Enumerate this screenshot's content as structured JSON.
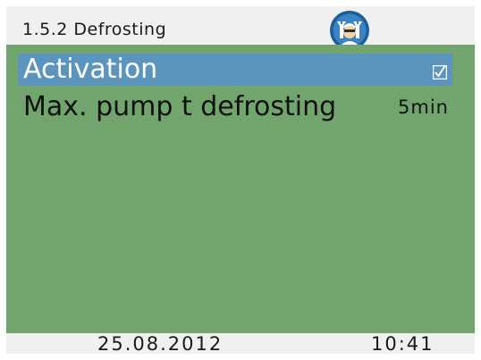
{
  "header": {
    "title": "1.5.2 Defrosting",
    "icon": "service-technician-icon"
  },
  "menu": {
    "items": [
      {
        "label": "Activation",
        "value_type": "checkbox",
        "checked": true,
        "selected": true
      },
      {
        "label": "Max. pump t defrosting",
        "value": "5min",
        "selected": false
      }
    ]
  },
  "footer": {
    "date": "25.08.2012",
    "time": "10:41"
  },
  "colors": {
    "content_bg": "#72a56d",
    "selection_bg": "#5b95bd",
    "bar_bg": "#f0f0f0",
    "icon_blue": "#2f6fa8"
  }
}
